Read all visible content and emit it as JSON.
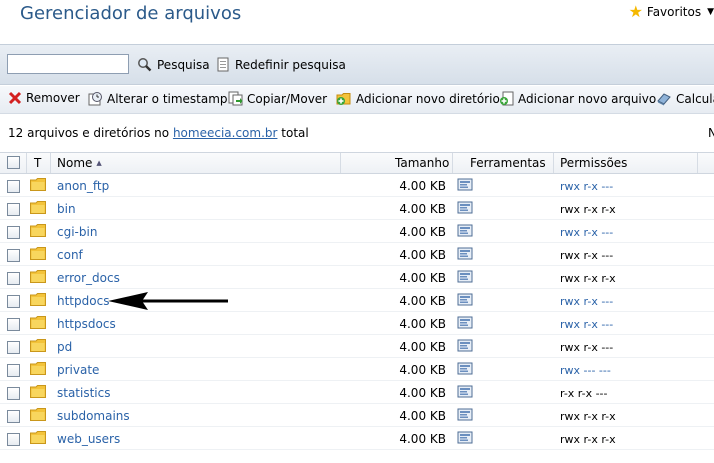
{
  "header": {
    "title": "Gerenciador de arquivos",
    "favorites_label": "Favoritos"
  },
  "search": {
    "button_label": "Pesquisa",
    "reset_label": "Redefinir pesquisa",
    "value": ""
  },
  "toolbar": {
    "remove_label": "Remover",
    "timestamp_label": "Alterar o timestamp",
    "copy_move_label": "Copiar/Mover",
    "add_dir_label": "Adicionar novo diretório",
    "add_file_label": "Adicionar novo arquivo",
    "calc_label": "Calcula"
  },
  "summary": {
    "prefix": "12 arquivos e diretórios no",
    "domain": "homeecia.com.br",
    "suffix": "total",
    "right_fragment": "N"
  },
  "table": {
    "headers": {
      "type": "T",
      "name": "Nome",
      "size": "Tamanho",
      "tools": "Ferramentas",
      "perms": "Permissões"
    },
    "rows": [
      {
        "name": "anon_ftp",
        "size": "4.00 KB",
        "perms": "rwx r-x ---",
        "perms_link": true
      },
      {
        "name": "bin",
        "size": "4.00 KB",
        "perms": "rwx r-x r-x",
        "perms_link": false
      },
      {
        "name": "cgi-bin",
        "size": "4.00 KB",
        "perms": "rwx r-x ---",
        "perms_link": true
      },
      {
        "name": "conf",
        "size": "4.00 KB",
        "perms": "rwx r-x ---",
        "perms_link": false
      },
      {
        "name": "error_docs",
        "size": "4.00 KB",
        "perms": "rwx r-x r-x",
        "perms_link": false
      },
      {
        "name": "httpdocs",
        "size": "4.00 KB",
        "perms": "rwx r-x ---",
        "perms_link": true
      },
      {
        "name": "httpsdocs",
        "size": "4.00 KB",
        "perms": "rwx r-x ---",
        "perms_link": true
      },
      {
        "name": "pd",
        "size": "4.00 KB",
        "perms": "rwx r-x ---",
        "perms_link": false
      },
      {
        "name": "private",
        "size": "4.00 KB",
        "perms": "rwx --- ---",
        "perms_link": true
      },
      {
        "name": "statistics",
        "size": "4.00 KB",
        "perms": "r-x r-x ---",
        "perms_link": false
      },
      {
        "name": "subdomains",
        "size": "4.00 KB",
        "perms": "rwx r-x r-x",
        "perms_link": false
      },
      {
        "name": "web_users",
        "size": "4.00 KB",
        "perms": "rwx r-x r-x",
        "perms_link": false
      }
    ]
  },
  "colors": {
    "link": "#2a62a8",
    "title": "#2b5a8a",
    "folder": "#f3c33a"
  }
}
